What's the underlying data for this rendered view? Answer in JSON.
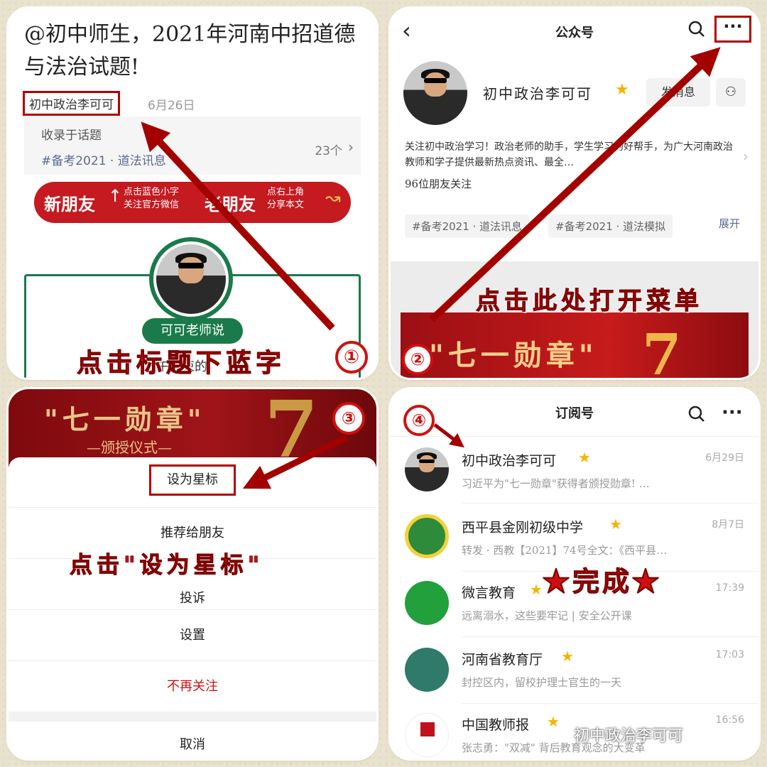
{
  "panel1": {
    "headline": "@初中师生，2021年河南中招道德与法治试题!",
    "author": "初中政治李可可",
    "date": "6月26日",
    "collection_label": "收录于话题",
    "collection_tag": "#备考2021 · 道法讯息",
    "collection_count": "23个",
    "banner_new": "新朋友",
    "banner_new_text": "点击蓝色小字\n关注官方微信",
    "banner_old": "老朋友",
    "banner_old_text": "点右上角\n分享本文",
    "pill": "可可老师说",
    "body_snippet": "上午结束的",
    "instruction": "点击标题下蓝字",
    "step": "①"
  },
  "panel2": {
    "nav_title": "公众号",
    "account_name": "初中政治李可可",
    "send_button": "发消息",
    "intro": "关注初中政治学习！政治老师的助手，学生学习的好帮手，为广大河南政治教师和学子提供最新热点资讯、最全…",
    "followers": "96位朋友关注",
    "tags": [
      "#备考2021 · 道法讯息",
      "#备考2021 · 道法模拟"
    ],
    "expand": "展开",
    "instruction": "点击此处打开菜单",
    "banner_text": "\"七一勋章\"",
    "step": "②"
  },
  "panel3": {
    "banner_text": "\"七一勋章\"",
    "banner_sub": "—颁授仪式—",
    "menu": [
      "设为星标",
      "推荐给朋友",
      "投诉",
      "设置",
      "不再关注",
      "取消"
    ],
    "instruction": "点击\"设为星标\"",
    "step": "③"
  },
  "panel4": {
    "nav_title": "订阅号",
    "step": "④",
    "done": "★完成★",
    "watermark": "初中政治李可可",
    "rows": [
      {
        "name": "初中政治李可可",
        "time": "6月29日",
        "desc": "习近平为\"七一勋章\"获得者颁授勋章! …"
      },
      {
        "name": "西平县金刚初级中学",
        "time": "8月7日",
        "desc": "转发 · 西教【2021】74号全文：《西平县…"
      },
      {
        "name": "微言教育",
        "time": "17:39",
        "desc": "远离溺水，这些要牢记 | 安全公开课"
      },
      {
        "name": "河南省教育厅",
        "time": "17:03",
        "desc": "封控区内，留校护理士官生的一天"
      },
      {
        "name": "中国教师报",
        "time": "16:56",
        "desc": "张志勇：\"双减\" 背后教育观念的大变革"
      }
    ]
  },
  "colors": {
    "accent_red": "#c0101a",
    "star": "#f5b400",
    "wechat_green": "#1a7a4a"
  }
}
